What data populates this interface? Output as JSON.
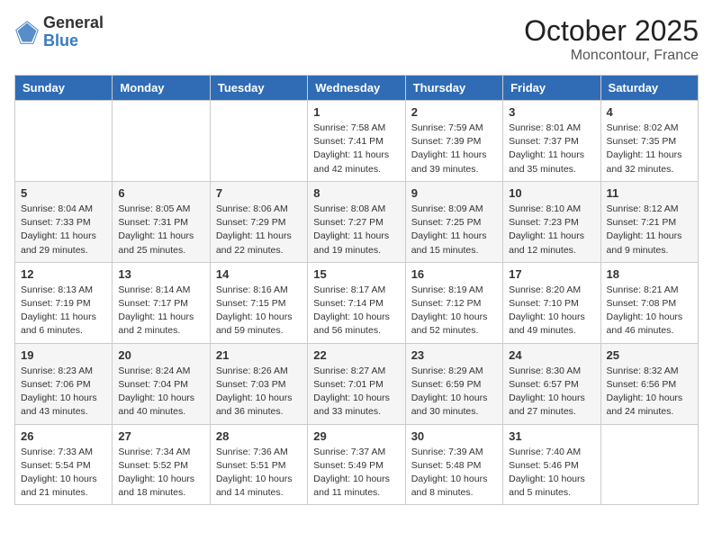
{
  "header": {
    "logo_general": "General",
    "logo_blue": "Blue",
    "month_title": "October 2025",
    "location": "Moncontour, France"
  },
  "weekdays": [
    "Sunday",
    "Monday",
    "Tuesday",
    "Wednesday",
    "Thursday",
    "Friday",
    "Saturday"
  ],
  "weeks": [
    [
      {
        "day": "",
        "info": ""
      },
      {
        "day": "",
        "info": ""
      },
      {
        "day": "",
        "info": ""
      },
      {
        "day": "1",
        "info": "Sunrise: 7:58 AM\nSunset: 7:41 PM\nDaylight: 11 hours\nand 42 minutes."
      },
      {
        "day": "2",
        "info": "Sunrise: 7:59 AM\nSunset: 7:39 PM\nDaylight: 11 hours\nand 39 minutes."
      },
      {
        "day": "3",
        "info": "Sunrise: 8:01 AM\nSunset: 7:37 PM\nDaylight: 11 hours\nand 35 minutes."
      },
      {
        "day": "4",
        "info": "Sunrise: 8:02 AM\nSunset: 7:35 PM\nDaylight: 11 hours\nand 32 minutes."
      }
    ],
    [
      {
        "day": "5",
        "info": "Sunrise: 8:04 AM\nSunset: 7:33 PM\nDaylight: 11 hours\nand 29 minutes."
      },
      {
        "day": "6",
        "info": "Sunrise: 8:05 AM\nSunset: 7:31 PM\nDaylight: 11 hours\nand 25 minutes."
      },
      {
        "day": "7",
        "info": "Sunrise: 8:06 AM\nSunset: 7:29 PM\nDaylight: 11 hours\nand 22 minutes."
      },
      {
        "day": "8",
        "info": "Sunrise: 8:08 AM\nSunset: 7:27 PM\nDaylight: 11 hours\nand 19 minutes."
      },
      {
        "day": "9",
        "info": "Sunrise: 8:09 AM\nSunset: 7:25 PM\nDaylight: 11 hours\nand 15 minutes."
      },
      {
        "day": "10",
        "info": "Sunrise: 8:10 AM\nSunset: 7:23 PM\nDaylight: 11 hours\nand 12 minutes."
      },
      {
        "day": "11",
        "info": "Sunrise: 8:12 AM\nSunset: 7:21 PM\nDaylight: 11 hours\nand 9 minutes."
      }
    ],
    [
      {
        "day": "12",
        "info": "Sunrise: 8:13 AM\nSunset: 7:19 PM\nDaylight: 11 hours\nand 6 minutes."
      },
      {
        "day": "13",
        "info": "Sunrise: 8:14 AM\nSunset: 7:17 PM\nDaylight: 11 hours\nand 2 minutes."
      },
      {
        "day": "14",
        "info": "Sunrise: 8:16 AM\nSunset: 7:15 PM\nDaylight: 10 hours\nand 59 minutes."
      },
      {
        "day": "15",
        "info": "Sunrise: 8:17 AM\nSunset: 7:14 PM\nDaylight: 10 hours\nand 56 minutes."
      },
      {
        "day": "16",
        "info": "Sunrise: 8:19 AM\nSunset: 7:12 PM\nDaylight: 10 hours\nand 52 minutes."
      },
      {
        "day": "17",
        "info": "Sunrise: 8:20 AM\nSunset: 7:10 PM\nDaylight: 10 hours\nand 49 minutes."
      },
      {
        "day": "18",
        "info": "Sunrise: 8:21 AM\nSunset: 7:08 PM\nDaylight: 10 hours\nand 46 minutes."
      }
    ],
    [
      {
        "day": "19",
        "info": "Sunrise: 8:23 AM\nSunset: 7:06 PM\nDaylight: 10 hours\nand 43 minutes."
      },
      {
        "day": "20",
        "info": "Sunrise: 8:24 AM\nSunset: 7:04 PM\nDaylight: 10 hours\nand 40 minutes."
      },
      {
        "day": "21",
        "info": "Sunrise: 8:26 AM\nSunset: 7:03 PM\nDaylight: 10 hours\nand 36 minutes."
      },
      {
        "day": "22",
        "info": "Sunrise: 8:27 AM\nSunset: 7:01 PM\nDaylight: 10 hours\nand 33 minutes."
      },
      {
        "day": "23",
        "info": "Sunrise: 8:29 AM\nSunset: 6:59 PM\nDaylight: 10 hours\nand 30 minutes."
      },
      {
        "day": "24",
        "info": "Sunrise: 8:30 AM\nSunset: 6:57 PM\nDaylight: 10 hours\nand 27 minutes."
      },
      {
        "day": "25",
        "info": "Sunrise: 8:32 AM\nSunset: 6:56 PM\nDaylight: 10 hours\nand 24 minutes."
      }
    ],
    [
      {
        "day": "26",
        "info": "Sunrise: 7:33 AM\nSunset: 5:54 PM\nDaylight: 10 hours\nand 21 minutes."
      },
      {
        "day": "27",
        "info": "Sunrise: 7:34 AM\nSunset: 5:52 PM\nDaylight: 10 hours\nand 18 minutes."
      },
      {
        "day": "28",
        "info": "Sunrise: 7:36 AM\nSunset: 5:51 PM\nDaylight: 10 hours\nand 14 minutes."
      },
      {
        "day": "29",
        "info": "Sunrise: 7:37 AM\nSunset: 5:49 PM\nDaylight: 10 hours\nand 11 minutes."
      },
      {
        "day": "30",
        "info": "Sunrise: 7:39 AM\nSunset: 5:48 PM\nDaylight: 10 hours\nand 8 minutes."
      },
      {
        "day": "31",
        "info": "Sunrise: 7:40 AM\nSunset: 5:46 PM\nDaylight: 10 hours\nand 5 minutes."
      },
      {
        "day": "",
        "info": ""
      }
    ]
  ]
}
